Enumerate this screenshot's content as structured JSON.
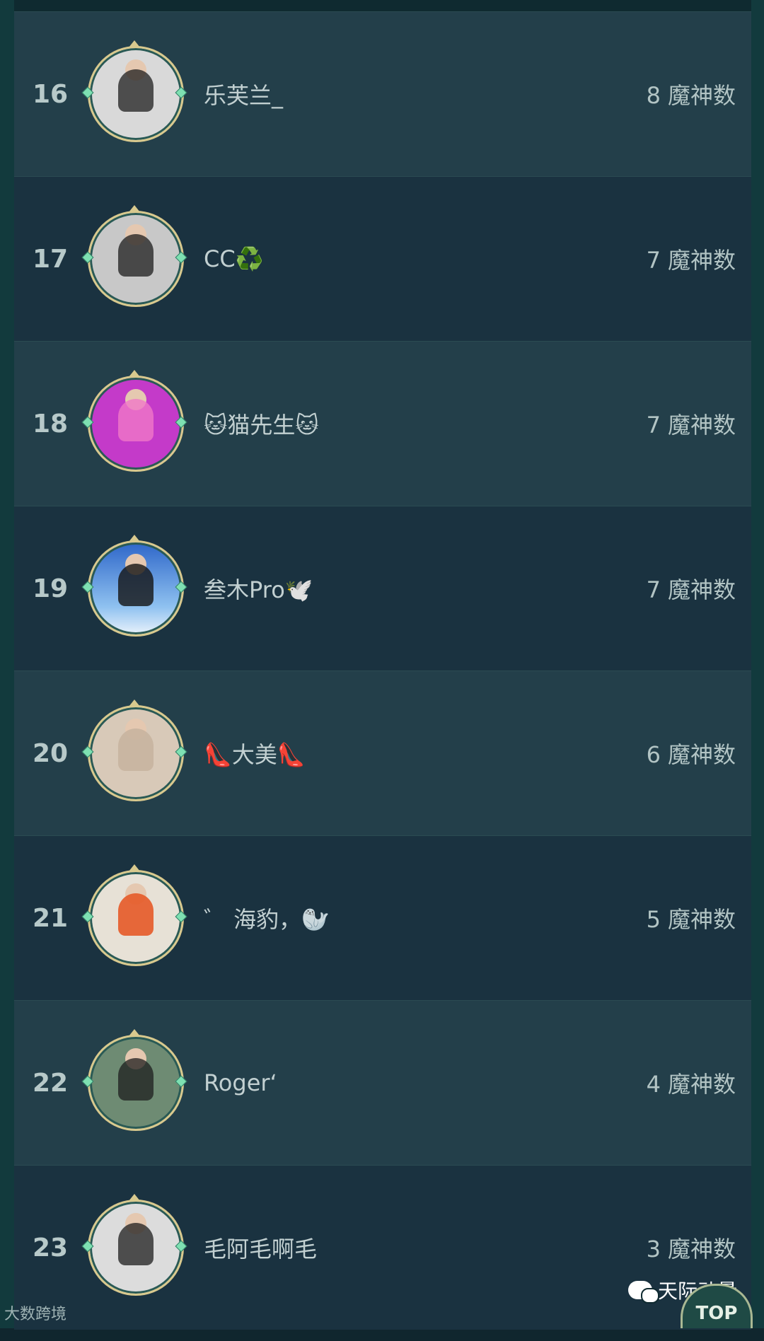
{
  "rows": [
    {
      "rank": "16",
      "name": "乐芙兰_",
      "score": "8",
      "unit": "魔神数",
      "avatar_color": "#d9d9d9"
    },
    {
      "rank": "17",
      "name": "CC♻️",
      "score": "7",
      "unit": "魔神数",
      "avatar_color": "#c8c8c8"
    },
    {
      "rank": "18",
      "name": "🐱猫先生🐱",
      "score": "7",
      "unit": "魔神数",
      "avatar_color": "#c43ac9"
    },
    {
      "rank": "19",
      "name": "叁木Pro🕊️",
      "score": "7",
      "unit": "魔神数",
      "avatar_color": "#2e66c9"
    },
    {
      "rank": "20",
      "name": "👠大美👠",
      "score": "6",
      "unit": "魔神数",
      "avatar_color": "#d8c9b8"
    },
    {
      "rank": "21",
      "name": "゛ 海豹，🦭",
      "score": "5",
      "unit": "魔神数",
      "avatar_color": "#e7e1d6"
    },
    {
      "rank": "22",
      "name": "Roger‘",
      "score": "4",
      "unit": "魔神数",
      "avatar_color": "#6e8b73"
    },
    {
      "rank": "23",
      "name": "毛阿毛啊毛",
      "score": "3",
      "unit": "魔神数",
      "avatar_color": "#dcdcdc"
    }
  ],
  "watermarks": {
    "left": "大数跨境",
    "right": "天际动量"
  },
  "top_button": "TOP",
  "icons": {
    "wechat": "wechat-icon",
    "avatar_frame": "gold-ring-frame"
  }
}
